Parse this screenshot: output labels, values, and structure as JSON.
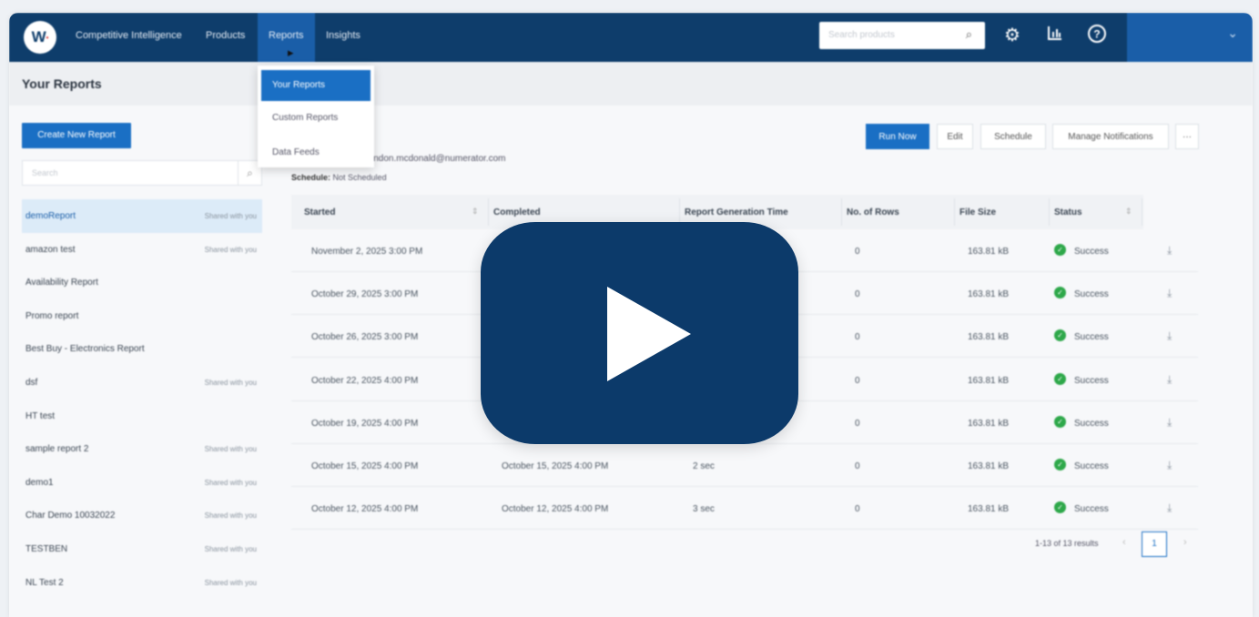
{
  "nav": {
    "logo": "W",
    "items": [
      "Competitive Intelligence",
      "Products",
      "Reports",
      "Insights"
    ],
    "search_placeholder": "Search products",
    "settings_icon": "gear-icon",
    "analytics_icon": "bar-chart-icon",
    "help_icon": "question-icon"
  },
  "dropdown": {
    "items": [
      "Your Reports",
      "Custom Reports",
      "Data Feeds"
    ]
  },
  "page": {
    "title": "Your Reports"
  },
  "sidebar": {
    "create_button": "Create New Report",
    "search_placeholder": "Search",
    "reports": [
      {
        "name": "demoReport",
        "shared": "Shared with you"
      },
      {
        "name": "amazon test",
        "shared": "Shared with you"
      },
      {
        "name": "Availability Report",
        "shared": ""
      },
      {
        "name": "Promo report",
        "shared": ""
      },
      {
        "name": "Best Buy - Electronics Report",
        "shared": ""
      },
      {
        "name": "dsf",
        "shared": "Shared with you"
      },
      {
        "name": "HT test",
        "shared": ""
      },
      {
        "name": "sample report 2",
        "shared": "Shared with you"
      },
      {
        "name": "demo1",
        "shared": "Shared with you"
      },
      {
        "name": "Char Demo 10032022",
        "shared": "Shared with you"
      },
      {
        "name": "TESTBEN",
        "shared": "Shared with you"
      },
      {
        "name": "NL Test 2",
        "shared": "Shared with you"
      }
    ]
  },
  "main": {
    "owner": "y brandon.mcdonald@numerator.com",
    "schedule_label": "Schedule:",
    "schedule_value": "Not Scheduled",
    "buttons": {
      "run_now": "Run Now",
      "edit": "Edit",
      "schedule": "Schedule",
      "manage_notifications": "Manage Notifications",
      "more": "···"
    },
    "columns": [
      "Started",
      "Completed",
      "Report Generation Time",
      "No. of Rows",
      "File Size",
      "Status"
    ],
    "rows": [
      {
        "started": "November 2, 2025  3:00 PM",
        "completed": "",
        "gen_time": "",
        "rows": "0",
        "size": "163.81 kB",
        "status": "Success"
      },
      {
        "started": "October 29, 2025  3:00 PM",
        "completed": "",
        "gen_time": "",
        "rows": "0",
        "size": "163.81 kB",
        "status": "Success"
      },
      {
        "started": "October 26, 2025  3:00 PM",
        "completed": "",
        "gen_time": "",
        "rows": "0",
        "size": "163.81 kB",
        "status": "Success"
      },
      {
        "started": "October 22, 2025  4:00 PM",
        "completed": "",
        "gen_time": "",
        "rows": "0",
        "size": "163.81 kB",
        "status": "Success"
      },
      {
        "started": "October 19, 2025  4:00 PM",
        "completed": "Oc",
        "gen_time": "",
        "rows": "0",
        "size": "163.81 kB",
        "status": "Success"
      },
      {
        "started": "October 15, 2025  4:00 PM",
        "completed": "October 15, 2025  4:00 PM",
        "gen_time": "2 sec",
        "rows": "0",
        "size": "163.81 kB",
        "status": "Success"
      },
      {
        "started": "October 12, 2025  4:00 PM",
        "completed": "October 12, 2025  4:00 PM",
        "gen_time": "3 sec",
        "rows": "0",
        "size": "163.81 kB",
        "status": "Success"
      }
    ],
    "pager": {
      "info": "1-13 of 13 results",
      "page": "1"
    }
  },
  "overlay": {
    "icon": "play-icon",
    "color": "#0c3a6a"
  }
}
